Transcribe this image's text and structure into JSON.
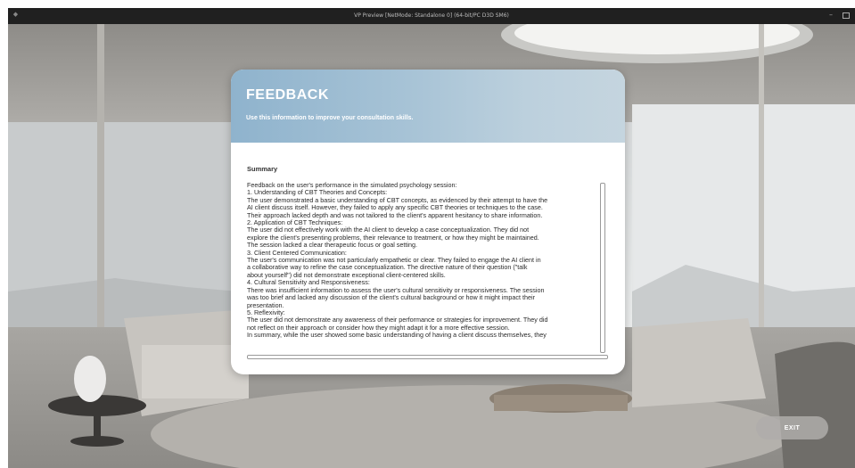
{
  "window": {
    "title": "VP Preview [NetMode: Standalone 0] (64-bit/PC D3D SM6)",
    "app_icon": "app-icon",
    "minimize_icon": "minimize-icon",
    "maximize_icon": "maximize-icon"
  },
  "feedback": {
    "title": "FEEDBACK",
    "subtitle": "Use this information to improve your consultation skills.",
    "summary_heading": "Summary",
    "summary_lines": [
      "Feedback on the user's performance in the simulated psychology session:",
      "1. Understanding of CBT Theories and Concepts:",
      "The user demonstrated a basic understanding of CBT concepts, as evidenced by their attempt to have the",
      "AI client discuss itself. However, they failed to apply any specific CBT theories or techniques to the case.",
      "Their approach lacked depth and was not tailored to the client's apparent hesitancy to share information.",
      "2. Application of CBT Techniques:",
      "The user did not effectively work with the AI client to develop a case conceptualization. They did not",
      "explore the client's presenting problems, their relevance to treatment, or how they might be maintained.",
      "The session lacked a clear therapeutic focus or goal setting.",
      "3. Client Centered Communication:",
      "The user's communication was not particularly empathetic or clear. They failed to engage the AI client in",
      "a collaborative way to refine the case conceptualization. The directive nature of their question (\"talk",
      "about yourself\") did not demonstrate exceptional client-centered skills.",
      "4. Cultural Sensitivity and Responsiveness:",
      "There was insufficient information to assess the user's cultural sensitivity or responsiveness. The session",
      "was too brief and lacked any discussion of the client's cultural background or how it might impact their",
      "presentation.",
      "5. Reflexivity:",
      "The user did not demonstrate any awareness of their performance or strategies for improvement. They did",
      "not reflect on their approach or consider how they might adapt it for a more effective session.",
      "In summary, while the user showed some basic understanding of having a client discuss themselves, they"
    ]
  },
  "exit_button": {
    "label": "EXIT"
  },
  "colors": {
    "header_gradient_start": "#8fb3cd",
    "header_gradient_end": "#c5d5df",
    "exit_button": "#afadaa",
    "titlebar": "#202020"
  }
}
